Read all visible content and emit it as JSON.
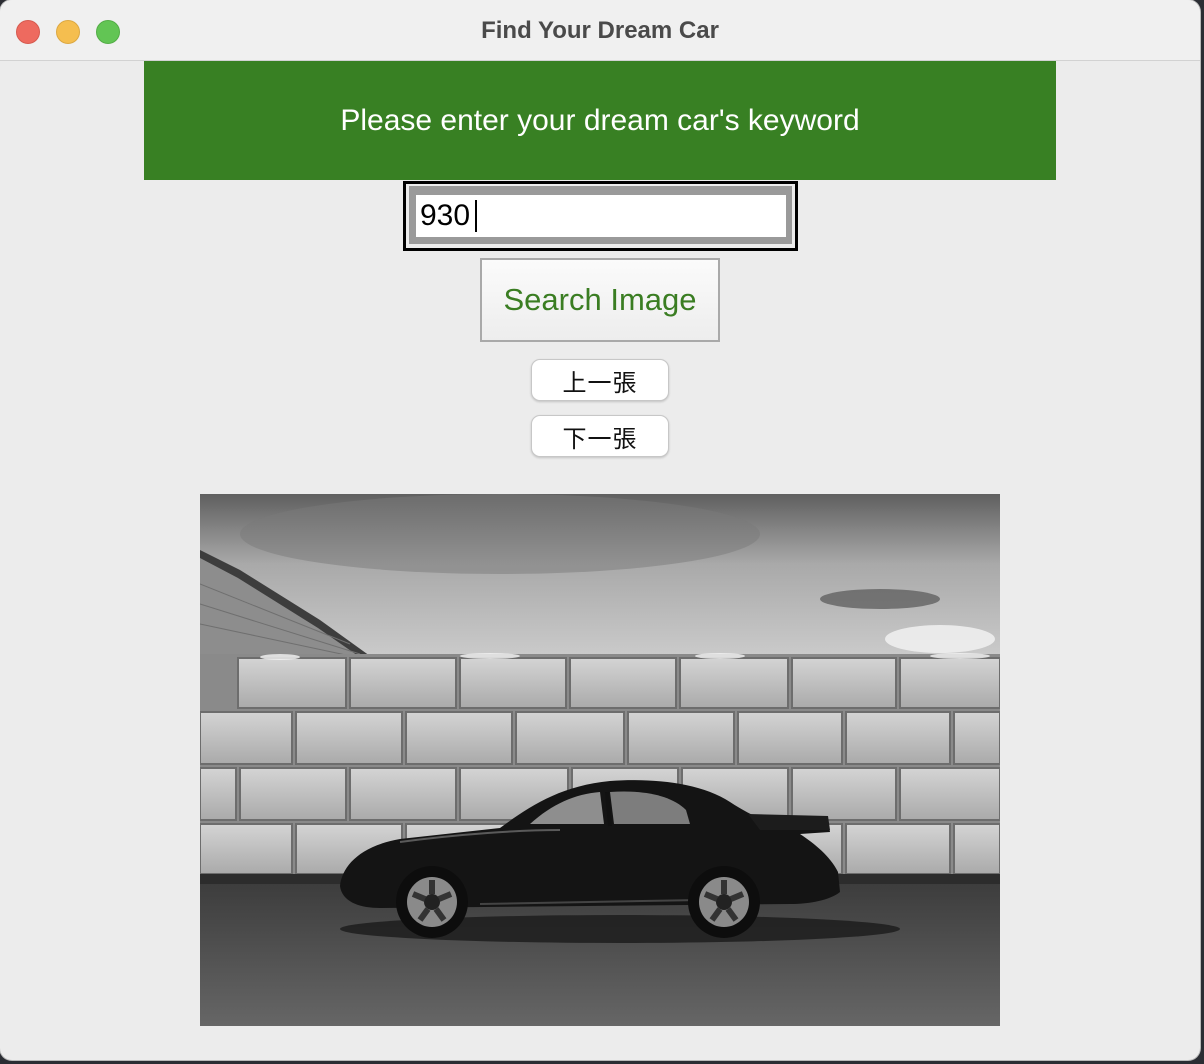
{
  "window": {
    "title": "Find Your Dream Car"
  },
  "banner": {
    "text": "Please enter your dream car's keyword",
    "background": "#388023",
    "text_color": "#ffffff"
  },
  "search": {
    "value": "930"
  },
  "buttons": {
    "search_label": "Search Image",
    "search_text_color": "#3a7d22",
    "previous_label": "上一張",
    "next_label": "下一張"
  },
  "image": {
    "alt": "Black and white photo of a black classic sports car parked in front of a concrete block wall",
    "icon": "photo-image"
  },
  "traffic_lights": {
    "close_color": "#ee6a5f",
    "minimize_color": "#f5be4f",
    "zoom_color": "#62c554"
  }
}
